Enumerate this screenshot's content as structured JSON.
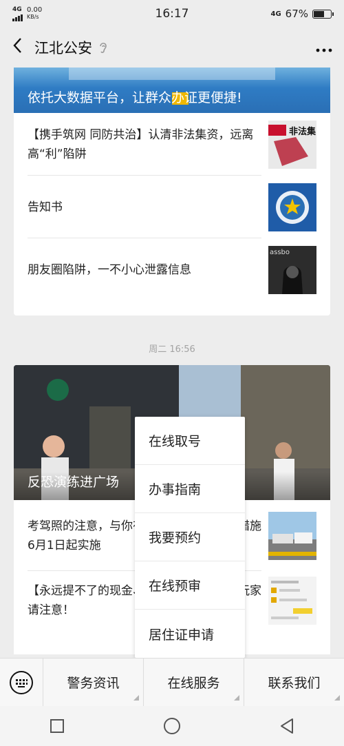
{
  "status": {
    "network": "4G",
    "speed_value": "0.00",
    "speed_unit": "KB/s",
    "time": "16:17",
    "network_right": "4G",
    "battery_pct": "67%",
    "battery_level": 0.67
  },
  "header": {
    "title": "江北公安"
  },
  "feed": {
    "card1": {
      "banner_caption": "依托大数据平台，让群众办证更便捷!",
      "items": [
        {
          "text": "【携手筑网 同防共治】认清非法集资，远离高“利”陷阱",
          "thumb_text": "非法集"
        },
        {
          "text": "告知书"
        },
        {
          "text": "朋友圈陷阱，一不小心泄露信息",
          "thumb_text": "assbo"
        }
      ]
    },
    "timestamp": "周二 16:56",
    "card2": {
      "banner_caption": "反恐演练进广场",
      "items": [
        {
          "text": "考驾照的注意，与你有关的公安交管便民措施6月1日起实施"
        },
        {
          "text": "【永远提不了的现金、永远赢不了的游戏玩家请注意！"
        }
      ]
    }
  },
  "popup_menu": {
    "items": [
      "在线取号",
      "办事指南",
      "我要预约",
      "在线预审",
      "居住证申请"
    ]
  },
  "tabbar": {
    "tabs": [
      "警务资讯",
      "在线服务",
      "联系我们"
    ]
  },
  "colors": {
    "accent_blue": "#2a6fb5",
    "background": "#ededed"
  }
}
